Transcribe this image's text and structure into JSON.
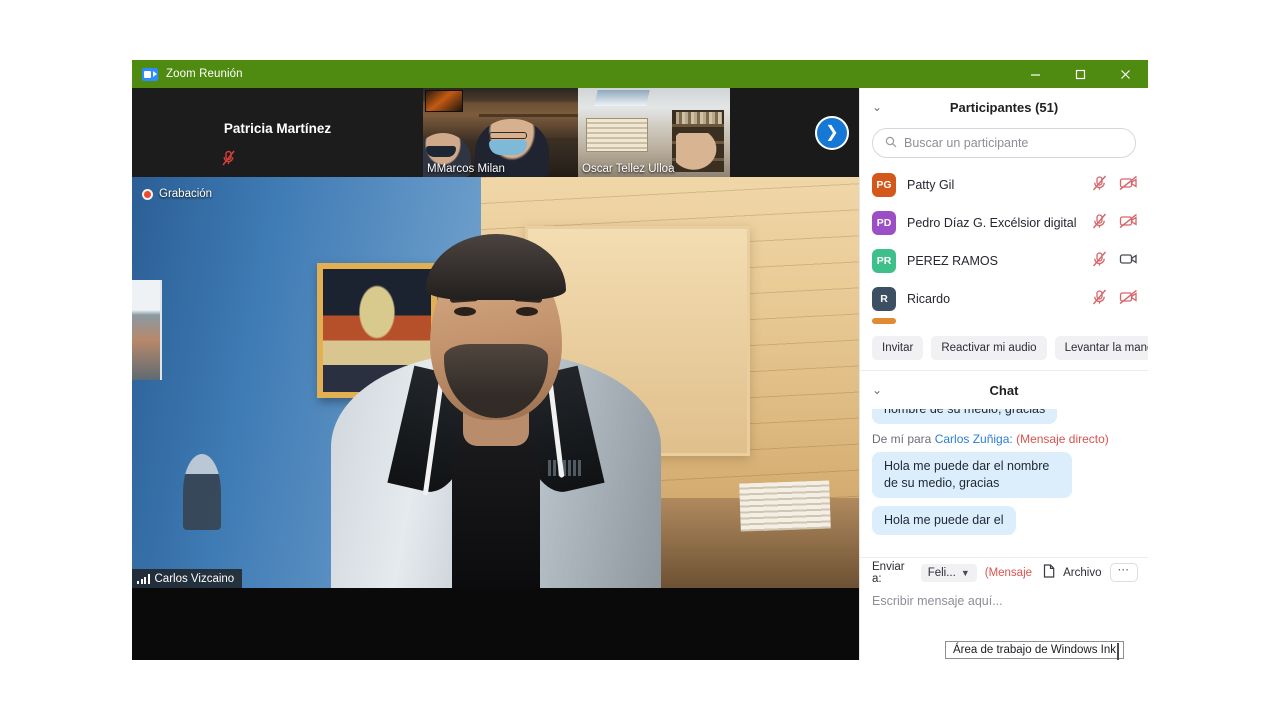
{
  "window": {
    "title": "Zoom Reunión",
    "app_icon": "zoom-camera-icon",
    "titlebar_color": "#4e8b10",
    "controls": {
      "minimize": "minimize-icon",
      "maximize": "maximize-icon",
      "close": "close-icon"
    }
  },
  "stage": {
    "recording": {
      "label": "Grabación",
      "icon": "record-dot-icon"
    },
    "active_speaker": {
      "name": "Carlos Vizcaino",
      "icon": "audio-level-icon"
    },
    "filmstrip": {
      "next_arrow_icon": "chevron-right-icon",
      "thumbnails": [
        {
          "name": "Patricia Martínez",
          "video_off": true,
          "muted": true,
          "mic_icon": "mic-muted-icon"
        },
        {
          "name": "MMarcos Milan",
          "video_off": false,
          "muted": false
        },
        {
          "name": "Oscar Tellez Ulloa",
          "video_off": false,
          "muted": false
        }
      ]
    }
  },
  "participants_panel": {
    "collapse_icon": "chevron-down-icon",
    "title": "Participantes (51)",
    "count": 51,
    "search": {
      "placeholder": "Buscar un participante",
      "value": "",
      "icon": "search-icon"
    },
    "rows": [
      {
        "initials": "PG",
        "name": "Patty Gil",
        "avatar_color": "#d4581a",
        "mic": "mic-muted-icon",
        "camera": "camera-off-icon",
        "mic_muted": true,
        "camera_off": true
      },
      {
        "initials": "PD",
        "name": "Pedro Díaz G. Excélsior digital",
        "avatar_color": "#9b4fc4",
        "mic": "mic-muted-icon",
        "camera": "camera-off-icon",
        "mic_muted": true,
        "camera_off": true
      },
      {
        "initials": "PR",
        "name": "PEREZ RAMOS",
        "avatar_color": "#3ec08a",
        "mic": "mic-muted-icon",
        "camera": "camera-on-icon",
        "mic_muted": true,
        "camera_off": false
      },
      {
        "initials": "R",
        "name": "Ricardo",
        "avatar_color": "#3d4f63",
        "mic": "mic-muted-icon",
        "camera": "camera-off-icon",
        "mic_muted": true,
        "camera_off": true
      }
    ],
    "actions": {
      "invite": "Invitar",
      "unmute": "Reactivar mi audio",
      "raise_hand": "Levantar la mano"
    }
  },
  "chat_panel": {
    "collapse_icon": "chevron-down-icon",
    "title": "Chat",
    "messages": [
      {
        "type": "bubble",
        "text": "nombre de su medio, gracias",
        "clipped": true
      },
      {
        "type": "meta",
        "prefix": "De mí para",
        "recipient": "Carlos Zuñiga:",
        "note": "(Mensaje directo)"
      },
      {
        "type": "bubble",
        "text": "Hola me puede dar el nombre de su medio, gracias",
        "clipped": false
      },
      {
        "type": "bubble",
        "text": "Hola me puede dar el",
        "clipped": true
      }
    ],
    "toolbar": {
      "send_to_label": "Enviar a:",
      "recipient": "Feli...",
      "recipient_caret_icon": "chevron-down-icon",
      "direct_note": "(Mensaje c",
      "file_icon": "file-icon",
      "file_label": "Archivo",
      "more_icon": "ellipsis-icon"
    },
    "input": {
      "placeholder": "Escribir mensaje aquí...",
      "value": ""
    }
  },
  "os_overlay": {
    "ink_tooltip": "Área de trabajo de Windows Ink"
  }
}
